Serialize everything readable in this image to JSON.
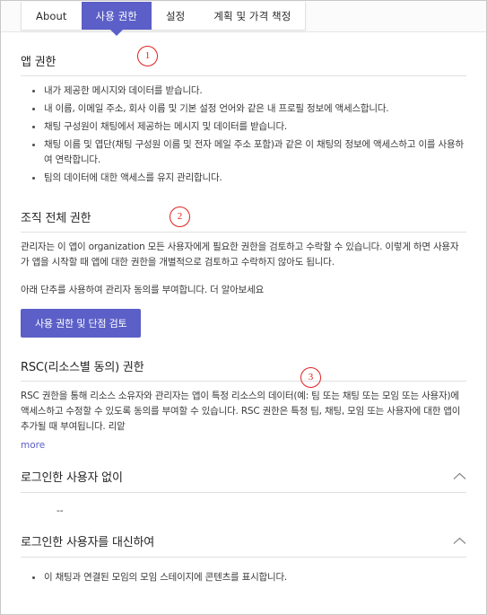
{
  "window": {
    "title": "사용 권한"
  },
  "tabs": [
    {
      "label": "About",
      "active": false
    },
    {
      "label": "사용 권한",
      "active": true
    },
    {
      "label": "설정",
      "active": false
    },
    {
      "label": "계획 및 가격 책정",
      "active": false
    }
  ],
  "annotations": [
    {
      "number": "1",
      "target": "앱 권한"
    },
    {
      "number": "2",
      "target": "조직 전체 권한"
    },
    {
      "number": "3",
      "target": "RSC(리소스별 동의) 권한"
    }
  ],
  "app_permissions": {
    "title": "앱 권한",
    "bullets": [
      "내가 제공한 메시지와 데이터를 받습니다.",
      "내 이름, 이메일 주소, 회사 이름 및 기본 설정 언어와 같은 내 프로필 정보에 액세스합니다.",
      "채팅 구성원이 채팅에서 제공하는 메시지 및 데이터를 받습니다.",
      "채팅 이름 및 엽단(채팅 구성원 이름 및 전자 메일 주소 포함)과 같은 이 채팅의 정보에 액세스하고 이를 사용하여 연락합니다.",
      "팀의 데이터에 대한 액세스를 유지 관리합니다."
    ]
  },
  "org_permissions": {
    "title": "조직 전체 권한",
    "paragraph": "관리자는 이 앱이 organization 모든 사용자에게 필요한 권한을 검토하고 수락할 수 있습니다. 이렇게 하면 사용자가 앱을 시작할 때 앱에 대한 권한을 개별적으로 검토하고 수락하지 않아도 됩니다.",
    "consent_text": "아래 단추를 사용하여 관리자 동의를 부여합니다. 더 알아보세요",
    "button_label": "사용 권한 및 단점 검토"
  },
  "rsc_permissions": {
    "title": "RSC(리소스별 동의) 권한",
    "paragraph": "RSC 권한을 통해 리소스 소유자와 관리자는 앱이 특정 리소스의 데이터(예: 팀 또는 채팅 또는 모임 또는 사용자)에 액세스하고 수정할 수 있도록 동의를 부여할 수 있습니다. RSC 권한은 특정 팀, 채팅, 모임 또는 사용자에 대한 앱이 추가될 때 부여됩니다. 리앝",
    "more_label": "more"
  },
  "accordions": [
    {
      "title": "로그인한 사용자 없이",
      "expanded": true,
      "chevron": "chevron-up-icon",
      "placeholder": "--",
      "bullets": []
    },
    {
      "title": "로그인한 사용자를 대신하여",
      "expanded": true,
      "chevron": "chevron-up-icon",
      "placeholder": "",
      "bullets": [
        "이 채팅과 연결된 모임의 모임 스테이지에 콘텐츠를 표시합니다."
      ]
    }
  ],
  "colors": {
    "accent": "#5b5fc7",
    "annotation": "#e02020",
    "text": "#242424",
    "body_text": "#3a3a3a",
    "rule": "#e0e0e0"
  }
}
